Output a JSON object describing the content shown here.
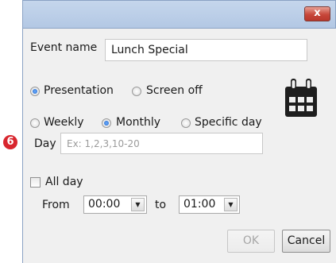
{
  "window": {
    "close_glyph": "x"
  },
  "form": {
    "event_name_label": "Event name",
    "event_name_value": "Lunch Special",
    "mode_options": [
      {
        "label": "Presentation",
        "checked": true
      },
      {
        "label": "Screen off",
        "checked": false
      }
    ],
    "recurrence_options": [
      {
        "label": "Weekly",
        "checked": false
      },
      {
        "label": "Monthly",
        "checked": true
      },
      {
        "label": "Specific day",
        "checked": false
      }
    ],
    "callout_number": "6",
    "day_label": "Day",
    "day_placeholder": "Ex: 1,2,3,10-20",
    "all_day_label": "All day",
    "all_day_checked": false,
    "from_label": "From",
    "from_value": "00:00",
    "to_label": "to",
    "to_value": "01:00"
  },
  "buttons": {
    "ok": "OK",
    "cancel": "Cancel"
  },
  "icons": {
    "calendar": "calendar-icon",
    "close": "close-icon",
    "dropdown": "chevron-down-icon"
  },
  "colors": {
    "accent": "#1f63c9",
    "badge": "#d8262e",
    "close": "#c7473a"
  }
}
